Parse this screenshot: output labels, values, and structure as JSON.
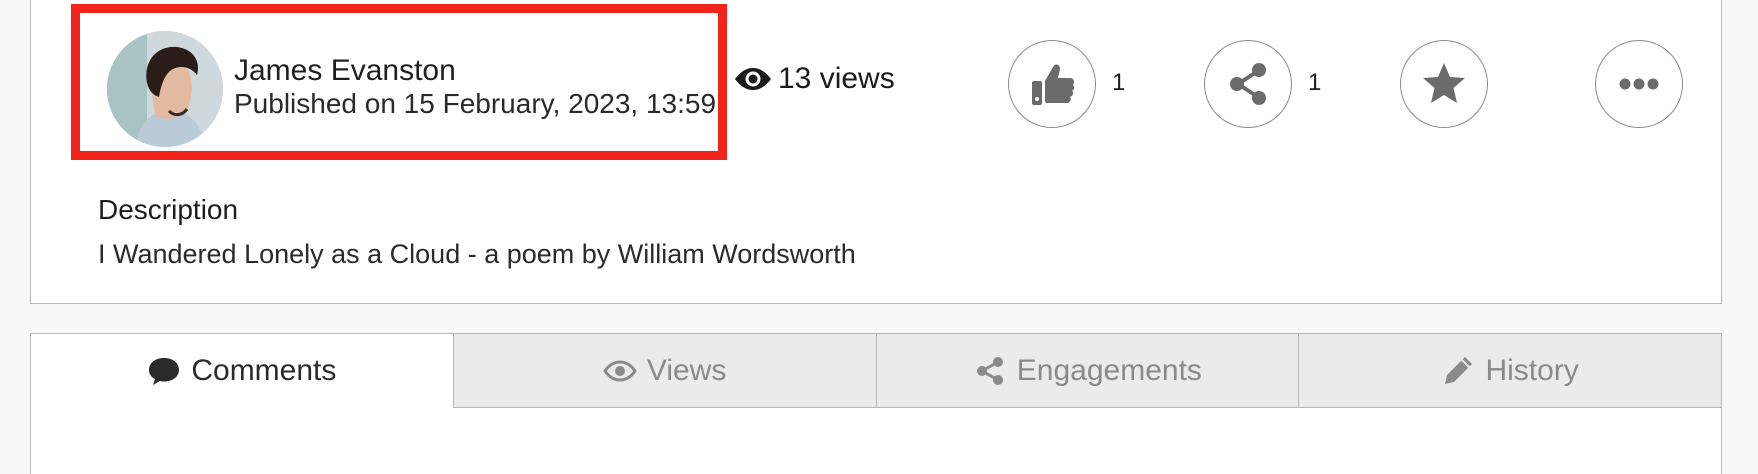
{
  "author": {
    "name": "James Evanston",
    "published": "Published on 15 February, 2023, 13:59"
  },
  "meta": {
    "views_label": "13 views"
  },
  "actions": {
    "like_count": "1",
    "share_count": "1"
  },
  "description": {
    "title": "Description",
    "text": "I Wandered Lonely as a Cloud - a poem by William Wordsworth"
  },
  "tabs": [
    {
      "label": "Comments",
      "icon": "comment-icon",
      "active": true
    },
    {
      "label": "Views",
      "icon": "eye-icon",
      "active": false
    },
    {
      "label": "Engagements",
      "icon": "share-icon",
      "active": false
    },
    {
      "label": "History",
      "icon": "pencil-icon",
      "active": false
    }
  ],
  "colors": {
    "highlight": "#f2231a",
    "icon_gray": "#6b6b6b",
    "tab_inactive_bg": "#ebebeb"
  }
}
